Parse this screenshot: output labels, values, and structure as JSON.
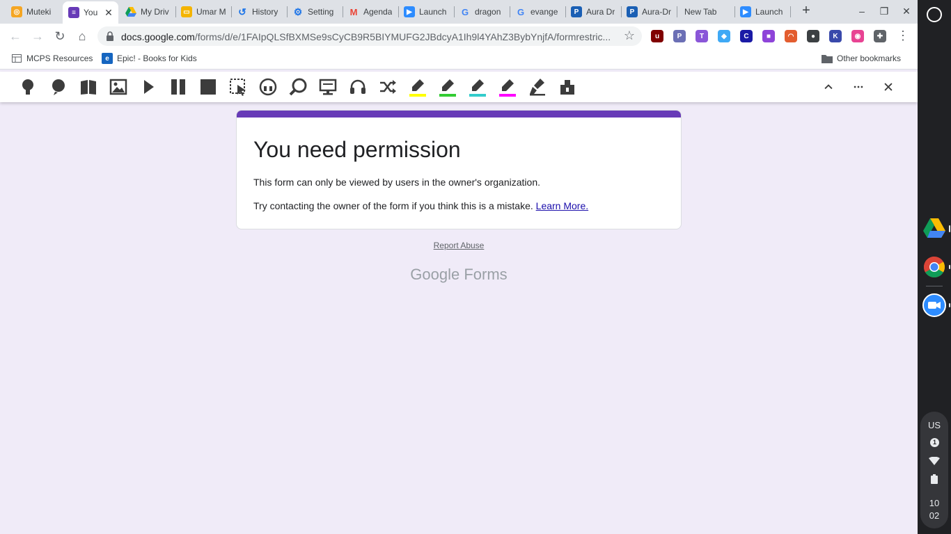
{
  "tabs": [
    {
      "title": "Muteki",
      "active": false
    },
    {
      "title": "You",
      "active": true
    },
    {
      "title": "My Driv",
      "active": false
    },
    {
      "title": "Umar M",
      "active": false
    },
    {
      "title": "History",
      "active": false
    },
    {
      "title": "Setting",
      "active": false
    },
    {
      "title": "Agenda",
      "active": false
    },
    {
      "title": "Launch",
      "active": false
    },
    {
      "title": "dragon",
      "active": false
    },
    {
      "title": "evange",
      "active": false
    },
    {
      "title": "Aura Dr",
      "active": false
    },
    {
      "title": "Aura-Dr",
      "active": false
    },
    {
      "title": "New Tab",
      "active": false
    },
    {
      "title": "Launch",
      "active": false
    }
  ],
  "tab_close_glyph": "✕",
  "new_tab_glyph": "+",
  "window_controls": {
    "minimize": "–",
    "restore": "❐",
    "close": "✕"
  },
  "url": {
    "host": "docs.google.com",
    "path": "/forms/d/e/1FAIpQLSfBXMSe9sCyCB9R5BIYMUFG2JBdcyA1Ih9l4YAhZ3BybYnjfA/formrestric..."
  },
  "bookmarks": [
    {
      "label": "MCPS Resources",
      "icon": "bookmark-grid-icon"
    },
    {
      "label": "Epic! - Books for Kids",
      "icon": "epic-icon"
    }
  ],
  "other_bookmarks": "Other bookmarks",
  "extensions": [
    {
      "name": "ublock-icon",
      "color": "#800000",
      "glyph": "u"
    },
    {
      "name": "pdf-icon",
      "color": "#6b6fb5",
      "glyph": "P"
    },
    {
      "name": "tw-icon",
      "color": "#8a56d8",
      "glyph": "T"
    },
    {
      "name": "diamond-icon",
      "color": "#3fa9f5",
      "glyph": "◆"
    },
    {
      "name": "c-icon",
      "color": "#1a1aa6",
      "glyph": "C"
    },
    {
      "name": "purple-shape-icon",
      "color": "#8e44d9",
      "glyph": "■"
    },
    {
      "name": "rainbow-icon",
      "color": "#e35d2f",
      "glyph": "◠"
    },
    {
      "name": "ninja-icon",
      "color": "#3c4043",
      "glyph": "●"
    },
    {
      "name": "k-icon",
      "color": "#3949ab",
      "glyph": "K"
    },
    {
      "name": "color-picker-icon",
      "color": "#e84393",
      "glyph": "◉"
    },
    {
      "name": "puzzle-icon",
      "color": "#5f6368",
      "glyph": "✚"
    }
  ],
  "rw_highlight_colors": [
    "#ffff00",
    "#33cc33",
    "#33cccc",
    "#ff00ff"
  ],
  "form": {
    "accent_color": "#673ab7",
    "title": "You need permission",
    "message1": "This form can only be viewed by users in the owner's organization.",
    "message2": "Try contacting the owner of the form if you think this is a mistake.",
    "learn_more": "Learn More.",
    "report_abuse": "Report Abuse",
    "logo": "Google Forms"
  },
  "status": {
    "keyboard": "US",
    "notifications": "1",
    "time_hour": "10",
    "time_min": "02"
  }
}
